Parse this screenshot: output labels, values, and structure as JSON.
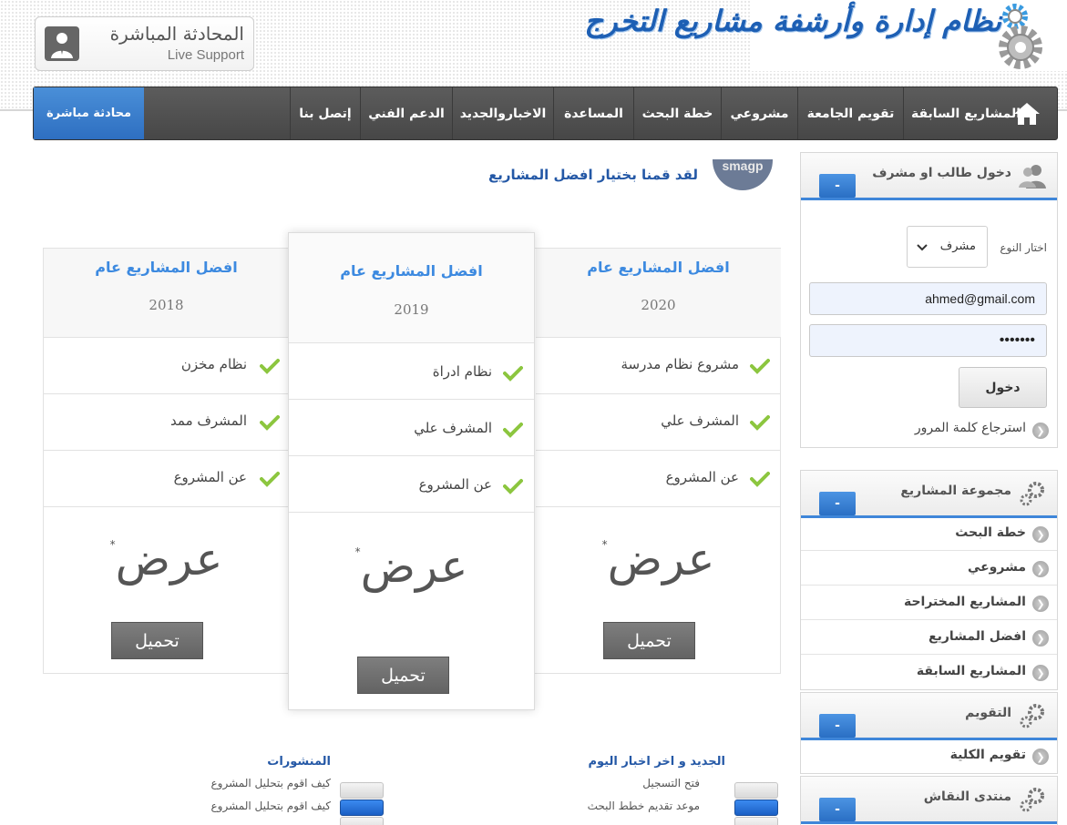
{
  "header": {
    "logo_text": "نظام إدارة وأرشفة مشاريع التخرج",
    "live_support_ar": "المحادثة المباشرة",
    "live_support_en": "Live Support"
  },
  "nav": {
    "chat": "محادثة مباشرة",
    "items": [
      "المشاريع السابقة",
      "تقويم الجامعة",
      "مشروعي",
      "خطة البحث",
      "المساعدة",
      "الاخباروالجديد",
      "الدعم الفني",
      "إتصل بنا"
    ]
  },
  "main": {
    "heading": "لقد قمنا بختيار افضل المشاريع",
    "badge_text": "smagp"
  },
  "pricing": [
    {
      "title": "افضل المشاريع عام",
      "year": "2020",
      "features": [
        "مشروع نظام مدرسة",
        "المشرف علي",
        "عن المشروع"
      ],
      "price": "عرض",
      "price_mark": "*",
      "button": "تحميل"
    },
    {
      "title": "افضل المشاريع عام",
      "year": "2019",
      "features": [
        "نظام ادراة",
        "المشرف علي",
        "عن المشروع"
      ],
      "price": "عرض",
      "price_mark": "*",
      "button": "تحميل"
    },
    {
      "title": "افضل المشاريع عام",
      "year": "2018",
      "features": [
        "نظام مخزن",
        "المشرف ممد",
        "عن المشروع"
      ],
      "price": "عرض",
      "price_mark": "*",
      "button": "تحميل"
    }
  ],
  "news": {
    "title": "الجديد و اخر اخبار اليوم",
    "items": [
      "فتح التسجيل",
      "موعد تقديم خطط البحث"
    ],
    "active_index": 1
  },
  "posts": {
    "title": "المنشورات",
    "items": [
      "كيف اقوم بتحليل المشروع",
      "كيف اقوم بتحليل المشروع"
    ],
    "active_index": 1
  },
  "login_panel": {
    "title": "دخول طالب او مشرف",
    "collapse": "-",
    "type_label": "اختار النوع",
    "type_selected": "مشرف",
    "email_value": "ahmed@gmail.com",
    "password_value": "•••••••",
    "login_button": "دخول",
    "forgot_link": "استرجاع كلمة المرور"
  },
  "projects_panel": {
    "title": "مجموعة المشاريع",
    "collapse": "-",
    "links": [
      "خطة البحث",
      "مشروعي",
      "المشاريع المختراحة",
      "افضل المشاريع",
      "المشاريع السابقة"
    ]
  },
  "calendar_panel": {
    "title": "التقويم",
    "collapse": "-",
    "links": [
      "تقويم الكلية"
    ]
  },
  "forum_panel": {
    "title": "منتدى النقاش",
    "collapse": "-"
  },
  "colors": {
    "accent": "#3f86d9",
    "nav_bg": "#4f4f4f",
    "heading": "#2458a6",
    "check": "#8cc63f"
  }
}
